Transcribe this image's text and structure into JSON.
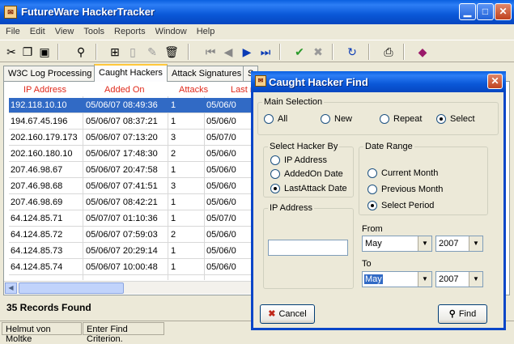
{
  "app": {
    "title": "FutureWare HackerTracker",
    "icon": "hacker-tracker-icon"
  },
  "menu": [
    "File",
    "Edit",
    "View",
    "Tools",
    "Reports",
    "Window",
    "Help"
  ],
  "toolbar": {
    "icons": [
      "cut-icon",
      "copy-icon",
      "paste-icon",
      "find-icon",
      "new-record-icon",
      "blank-page-icon",
      "edit-icon",
      "delete-icon",
      "first-icon",
      "previous-icon",
      "next-icon",
      "last-icon",
      "check-icon",
      "cancel-icon",
      "refresh-icon",
      "print-icon",
      "book-icon"
    ]
  },
  "tabs": [
    {
      "label": "W3C Log Processing",
      "active": false
    },
    {
      "label": "Caught Hackers",
      "active": true
    },
    {
      "label": "Attack Signatures",
      "active": false
    },
    {
      "label": "S",
      "active": false
    }
  ],
  "grid": {
    "columns": [
      "IP Address",
      "Added On",
      "Attacks",
      "Last m"
    ],
    "rows": [
      {
        "ip": "192.118.10.10",
        "added": "05/06/07 08:49:36",
        "attacks": "1",
        "last": "05/06/0",
        "selected": true
      },
      {
        "ip": "194.67.45.196",
        "added": "05/06/07 08:37:21",
        "attacks": "1",
        "last": "05/06/0",
        "selected": false
      },
      {
        "ip": "202.160.179.173",
        "added": "05/06/07 07:13:20",
        "attacks": "3",
        "last": "05/07/0",
        "selected": false
      },
      {
        "ip": "202.160.180.10",
        "added": "05/06/07 17:48:30",
        "attacks": "2",
        "last": "05/06/0",
        "selected": false
      },
      {
        "ip": "207.46.98.67",
        "added": "05/06/07 20:47:58",
        "attacks": "1",
        "last": "05/06/0",
        "selected": false
      },
      {
        "ip": "207.46.98.68",
        "added": "05/06/07 07:41:51",
        "attacks": "3",
        "last": "05/06/0",
        "selected": false
      },
      {
        "ip": "207.46.98.69",
        "added": "05/06/07 08:42:21",
        "attacks": "1",
        "last": "05/06/0",
        "selected": false
      },
      {
        "ip": "64.124.85.71",
        "added": "05/07/07 01:10:36",
        "attacks": "1",
        "last": "05/07/0",
        "selected": false
      },
      {
        "ip": "64.124.85.72",
        "added": "05/06/07 07:59:03",
        "attacks": "2",
        "last": "05/06/0",
        "selected": false
      },
      {
        "ip": "64.124.85.73",
        "added": "05/06/07 20:29:14",
        "attacks": "1",
        "last": "05/06/0",
        "selected": false
      },
      {
        "ip": "64.124.85.74",
        "added": "05/06/07 10:00:48",
        "attacks": "1",
        "last": "05/06/0",
        "selected": false
      }
    ]
  },
  "records_found": "35 Records Found",
  "status": {
    "user": "Helmut von Moltke",
    "message": "Enter Find Criterion."
  },
  "dialog": {
    "title": "Caught Hacker Find",
    "main_selection": {
      "legend": "Main Selection",
      "options": [
        {
          "label": "All",
          "checked": false
        },
        {
          "label": "New",
          "checked": false
        },
        {
          "label": "Repeat",
          "checked": false
        },
        {
          "label": "Select",
          "checked": true
        }
      ]
    },
    "select_by": {
      "legend": "Select Hacker By",
      "options": [
        {
          "label": "IP Address",
          "checked": false
        },
        {
          "label": "AddedOn Date",
          "checked": false
        },
        {
          "label": "LastAttack Date",
          "checked": true
        }
      ]
    },
    "date_range": {
      "legend": "Date Range",
      "options": [
        {
          "label": "Current Month",
          "checked": false
        },
        {
          "label": "Previous Month",
          "checked": false
        },
        {
          "label": "Select Period",
          "checked": true
        }
      ]
    },
    "ip_address": {
      "legend": "IP Address",
      "value": ""
    },
    "from": {
      "label": "From",
      "month": "May",
      "year": "2007"
    },
    "to": {
      "label": "To",
      "month": "May",
      "year": "2007"
    },
    "cancel_label": "Cancel",
    "find_label": "Find"
  }
}
